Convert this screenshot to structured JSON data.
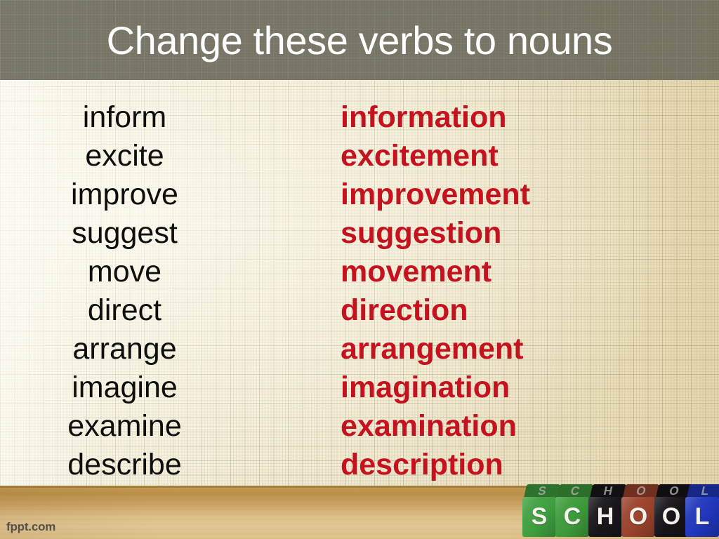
{
  "slide": {
    "title": "Change these verbs to nouns",
    "title_color": "#ffffff",
    "title_bar_color": "#686658",
    "background": "graph-paper",
    "verb_color": "#100f0d",
    "noun_color": "#c4121f"
  },
  "word_pairs": [
    {
      "verb": "inform",
      "noun": "information"
    },
    {
      "verb": "excite",
      "noun": "excitement"
    },
    {
      "verb": "improve",
      "noun": "improvement"
    },
    {
      "verb": "suggest",
      "noun": "suggestion"
    },
    {
      "verb": "move",
      "noun": "movement"
    },
    {
      "verb": "direct",
      "noun": "direction"
    },
    {
      "verb": "arrange",
      "noun": "arrangement"
    },
    {
      "verb": "imagine",
      "noun": "imagination"
    },
    {
      "verb": "examine",
      "noun": "examination"
    },
    {
      "verb": "describe",
      "noun": "description"
    }
  ],
  "footer": {
    "watermark": "fppt.com"
  },
  "blocks": {
    "word": "SCHOOL",
    "letters": [
      {
        "letter": "S",
        "color": "#3f9f3f"
      },
      {
        "letter": "C",
        "color": "#3c9a3a"
      },
      {
        "letter": "H",
        "color": "#18161a"
      },
      {
        "letter": "O",
        "color": "#9a422c"
      },
      {
        "letter": "O",
        "color": "#161419"
      },
      {
        "letter": "L",
        "color": "#2036bc"
      }
    ]
  }
}
